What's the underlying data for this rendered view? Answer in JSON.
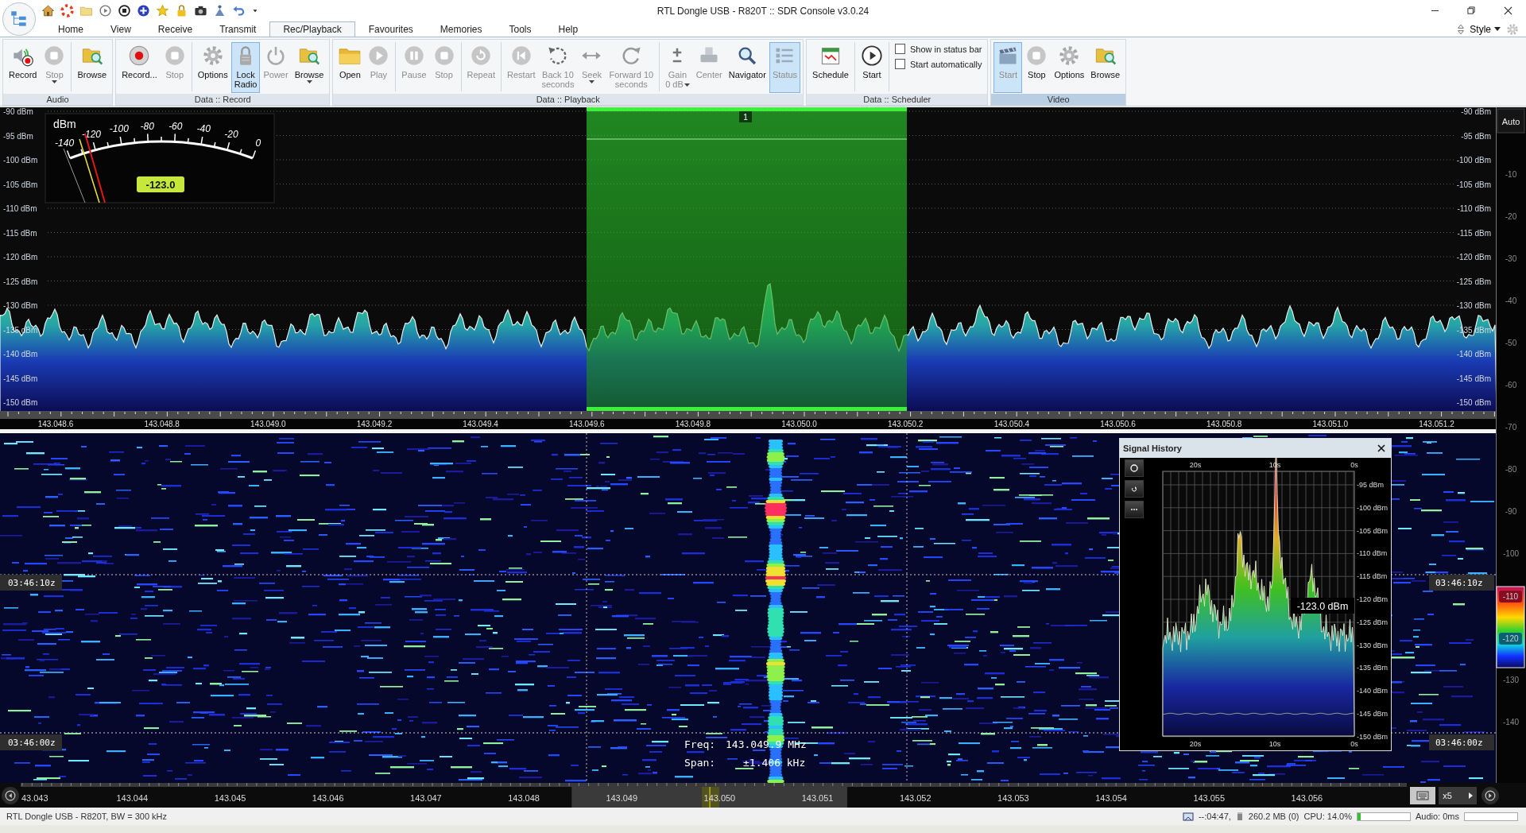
{
  "title_bar": {
    "title": "RTL Dongle USB - R820T :: SDR Console v3.0.24"
  },
  "menu_tabs": [
    {
      "label": "Home",
      "selected": false
    },
    {
      "label": "View",
      "selected": false
    },
    {
      "label": "Receive",
      "selected": false
    },
    {
      "label": "Transmit",
      "selected": false
    },
    {
      "label": "Rec/Playback",
      "selected": true
    },
    {
      "label": "Favourites",
      "selected": false
    },
    {
      "label": "Memories",
      "selected": false
    },
    {
      "label": "Tools",
      "selected": false
    },
    {
      "label": "Help",
      "selected": false
    }
  ],
  "style_menu": {
    "label": "Style"
  },
  "ribbon": [
    {
      "label": "Audio",
      "highlighted": false,
      "clusters": [
        [
          {
            "kind": "button",
            "label": "Record",
            "disabled": false,
            "selected": false,
            "dropdown": false
          },
          {
            "kind": "button",
            "label": "Stop",
            "disabled": true,
            "selected": false,
            "dropdown": true
          }
        ],
        [
          {
            "kind": "button",
            "label": "Browse",
            "disabled": false,
            "selected": false,
            "dropdown": false
          }
        ]
      ]
    },
    {
      "label": "Data :: Record",
      "highlighted": false,
      "clusters": [
        [
          {
            "kind": "button",
            "label": "Record...",
            "disabled": false,
            "selected": false,
            "dropdown": false
          },
          {
            "kind": "button",
            "label": "Stop",
            "disabled": true,
            "selected": false,
            "dropdown": false
          }
        ],
        [
          {
            "kind": "button",
            "label": "Options",
            "disabled": false,
            "selected": false,
            "dropdown": false
          },
          {
            "kind": "button",
            "label": "Lock\nRadio",
            "disabled": false,
            "selected": true,
            "dropdown": false
          },
          {
            "kind": "button",
            "label": "Power",
            "disabled": true,
            "selected": false,
            "dropdown": false
          },
          {
            "kind": "button",
            "label": "Browse",
            "disabled": false,
            "selected": false,
            "dropdown": true
          }
        ]
      ]
    },
    {
      "label": "Data :: Playback",
      "highlighted": false,
      "clusters": [
        [
          {
            "kind": "button",
            "label": "Open",
            "disabled": false,
            "selected": false,
            "dropdown": false
          },
          {
            "kind": "button",
            "label": "Play",
            "disabled": true,
            "selected": false,
            "dropdown": false
          }
        ],
        [
          {
            "kind": "button",
            "label": "Pause",
            "disabled": true,
            "selected": false,
            "dropdown": false
          },
          {
            "kind": "button",
            "label": "Stop",
            "disabled": true,
            "selected": false,
            "dropdown": false
          }
        ],
        [
          {
            "kind": "button",
            "label": "Repeat",
            "disabled": true,
            "selected": false,
            "dropdown": false
          }
        ],
        [
          {
            "kind": "button",
            "label": "Restart",
            "disabled": true,
            "selected": false,
            "dropdown": false
          },
          {
            "kind": "button",
            "label": "Back 10\nseconds",
            "disabled": true,
            "selected": false,
            "dropdown": false
          },
          {
            "kind": "button",
            "label": "Seek",
            "disabled": true,
            "selected": false,
            "dropdown": true
          },
          {
            "kind": "button",
            "label": "Forward 10\nseconds",
            "disabled": true,
            "selected": false,
            "dropdown": false
          }
        ],
        [
          {
            "kind": "button",
            "label": "Gain\n0 dB",
            "disabled": true,
            "selected": false,
            "dropdown": true
          },
          {
            "kind": "button",
            "label": "Center",
            "disabled": true,
            "selected": false,
            "dropdown": false
          },
          {
            "kind": "button",
            "label": "Navigator",
            "disabled": false,
            "selected": false,
            "dropdown": false
          },
          {
            "kind": "button",
            "label": "Status",
            "disabled": true,
            "selected": true,
            "dropdown": false
          }
        ]
      ]
    },
    {
      "label": "Data :: Scheduler",
      "highlighted": false,
      "clusters": [
        [
          {
            "kind": "button",
            "label": "Schedule",
            "disabled": false,
            "selected": false,
            "dropdown": false
          }
        ],
        [
          {
            "kind": "button",
            "label": "Start",
            "disabled": false,
            "selected": false,
            "dropdown": false
          }
        ],
        [
          {
            "kind": "checkbox",
            "label": "Show in status bar",
            "checked": false
          },
          {
            "kind": "checkbox",
            "label": "Start automatically",
            "checked": false
          }
        ]
      ]
    },
    {
      "label": "Video",
      "highlighted": true,
      "clusters": [
        [
          {
            "kind": "button",
            "label": "Start",
            "disabled": true,
            "selected": true,
            "dropdown": false
          },
          {
            "kind": "button",
            "label": "Stop",
            "disabled": false,
            "selected": false,
            "dropdown": false
          },
          {
            "kind": "button",
            "label": "Options",
            "disabled": false,
            "selected": false,
            "dropdown": false
          },
          {
            "kind": "button",
            "label": "Browse",
            "disabled": false,
            "selected": false,
            "dropdown": false
          }
        ]
      ]
    }
  ],
  "spectrum": {
    "left_scale": [
      "-90 dBm",
      "-95 dBm",
      "-100 dBm",
      "-105 dBm",
      "-110 dBm",
      "-115 dBm",
      "-120 dBm",
      "-125 dBm",
      "-130 dBm",
      "-135 dBm",
      "-140 dBm",
      "-145 dBm",
      "-150 dBm"
    ],
    "right_scale": [
      "-90 dBm",
      "-95 dBm",
      "-100 dBm",
      "-105 dBm",
      "-110 dBm",
      "-115 dBm",
      "-120 dBm",
      "-125 dBm",
      "-130 dBm",
      "-135 dBm",
      "-140 dBm",
      "-145 dBm",
      "-150 dBm"
    ],
    "frequency_axis": [
      "143.048.6",
      "143.048.8",
      "143.049.0",
      "143.049.2",
      "143.049.4",
      "143.049.6",
      "143.049.8",
      "143.050.0",
      "143.050.2",
      "143.050.4",
      "143.050.6",
      "143.050.8",
      "143.051.0",
      "143.051.2"
    ],
    "filter": {
      "label": "1"
    },
    "meter": {
      "unit": "dBm",
      "scale": [
        "-140",
        "-120",
        "-100",
        "-80",
        "-60",
        "-40",
        "-20",
        "0"
      ],
      "reading": "-123.0"
    }
  },
  "level_scale": {
    "button": "Auto",
    "ticks_above": [
      "-10",
      "-20",
      "-30",
      "-40",
      "-50",
      "-60",
      "-70",
      "-80",
      "-90",
      "-100"
    ],
    "color_bar_labels": [
      "-110",
      "-120"
    ],
    "ticks_below": [
      "-130",
      "-140"
    ]
  },
  "waterfall": {
    "left_timestamps": [
      "03:46:10z",
      "03:46:00z"
    ],
    "right_timestamps": [
      "03:46:10z",
      "03:46:00z"
    ],
    "readout": [
      {
        "label": "Freq:",
        "value": "143.049.9 MHz"
      },
      {
        "label": "Span:",
        "value": "±1.406 kHz"
      }
    ]
  },
  "signal_history": {
    "title": "Signal History",
    "time_axis_top": [
      "20s",
      "10s",
      "0s"
    ],
    "time_axis_bottom": [
      "20s",
      "10s",
      "0s"
    ],
    "level_axis": [
      "-95 dBm",
      "-100 dBm",
      "-105 dBm",
      "-110 dBm",
      "-115 dBm",
      "-120 dBm",
      "-125 dBm",
      "-130 dBm",
      "-135 dBm",
      "-140 dBm",
      "-145 dBm",
      "-150 dBm"
    ],
    "reading": "-123.0 dBm"
  },
  "frequency_bar": {
    "labels": [
      "43.043",
      "143.044",
      "143.045",
      "143.046",
      "143.047",
      "143.048",
      "143.049",
      "143.050",
      "143.051",
      "143.052",
      "143.053",
      "143.054",
      "143.055",
      "143.056"
    ],
    "zoom": "x5"
  },
  "status_bar": {
    "device": "RTL Dongle USB - R820T, BW = 300 kHz",
    "time": "--:04:47,",
    "memory": "260.2 MB (0)",
    "cpu": "CPU: 14.0%",
    "cpu_load": {
      "level": 0.06
    },
    "audio": "Audio: 0ms",
    "audio_buffer": {
      "level": 0
    }
  }
}
